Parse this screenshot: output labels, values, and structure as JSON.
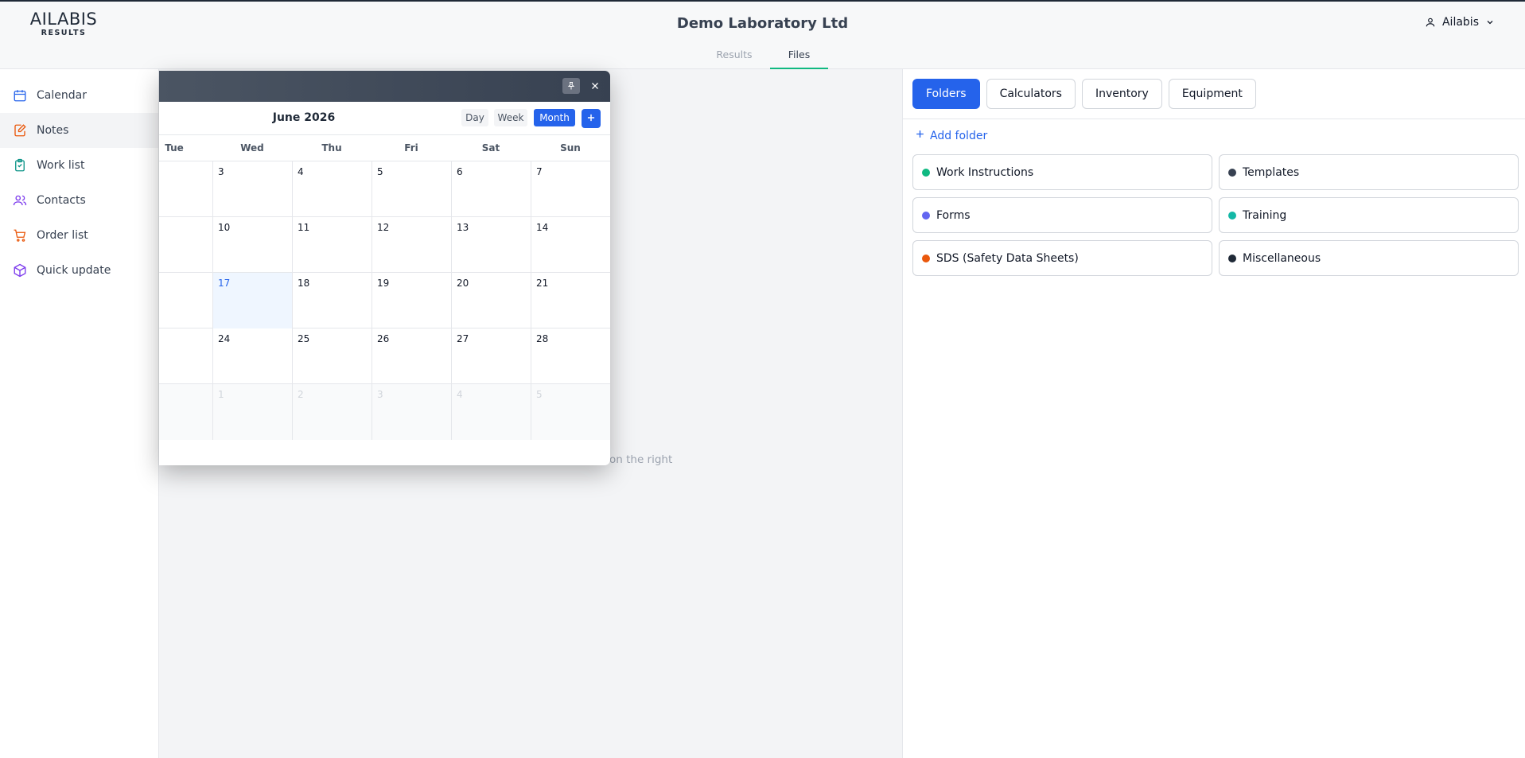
{
  "header": {
    "logo_main": "AILABIS",
    "logo_sub": "RESULTS",
    "title": "Demo Laboratory Ltd",
    "user_name": "Ailabis"
  },
  "subnav": {
    "tabs": [
      {
        "label": "Results",
        "active": false
      },
      {
        "label": "Files",
        "active": true
      }
    ],
    "accent": "#10b981"
  },
  "sidebar": {
    "items": [
      {
        "label": "Calendar",
        "icon": "calendar-icon",
        "color": "#2563eb"
      },
      {
        "label": "Notes",
        "icon": "notes-icon",
        "color": "#ea580c",
        "active": true
      },
      {
        "label": "Work list",
        "icon": "clipboard-icon",
        "color": "#0d9488"
      },
      {
        "label": "Contacts",
        "icon": "users-icon",
        "color": "#7c3aed"
      },
      {
        "label": "Order list",
        "icon": "cart-icon",
        "color": "#ea580c"
      },
      {
        "label": "Quick update",
        "icon": "box-icon",
        "color": "#7c3aed"
      }
    ]
  },
  "main": {
    "hint_fragment": "on the right"
  },
  "calendar": {
    "month_label": "June 2026",
    "views": [
      "Day",
      "Week",
      "Month"
    ],
    "active_view": "Month",
    "add_label": "+",
    "days_of_week": [
      "Tue",
      "Wed",
      "Thu",
      "Fri",
      "Sat",
      "Sun"
    ],
    "today": "17",
    "weeks": [
      [
        "3",
        "4",
        "5",
        "6",
        "7"
      ],
      [
        "10",
        "11",
        "12",
        "13",
        "14"
      ],
      [
        "17",
        "18",
        "19",
        "20",
        "21"
      ],
      [
        "24",
        "25",
        "26",
        "27",
        "28"
      ],
      [
        "1",
        "2",
        "3",
        "4",
        "5"
      ]
    ]
  },
  "right": {
    "tabs": [
      "Folders",
      "Calculators",
      "Inventory",
      "Equipment"
    ],
    "active_tab": "Folders",
    "add_folder_label": "Add folder",
    "folders": [
      {
        "label": "Work Instructions",
        "color": "#10b981"
      },
      {
        "label": "Templates",
        "color": "#374151"
      },
      {
        "label": "Forms",
        "color": "#6366f1"
      },
      {
        "label": "Training",
        "color": "#14b8a6"
      },
      {
        "label": "SDS (Safety Data Sheets)",
        "color": "#ea580c"
      },
      {
        "label": "Miscellaneous",
        "color": "#1f2937"
      }
    ]
  }
}
